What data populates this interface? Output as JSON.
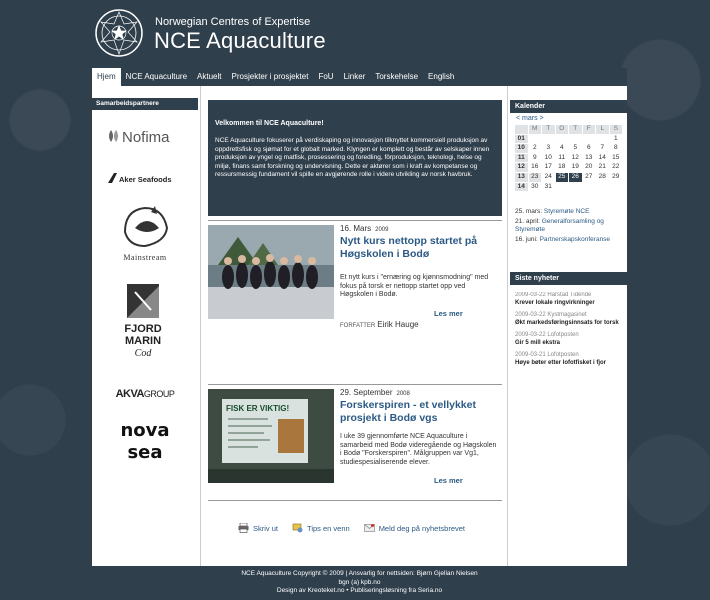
{
  "header": {
    "tagline": "Norwegian Centres of Expertise",
    "title": "NCE Aquaculture"
  },
  "nav": {
    "items": [
      {
        "label": "Hjem",
        "active": true
      },
      {
        "label": "NCE Aquaculture"
      },
      {
        "label": "Aktuelt"
      },
      {
        "label": "Prosjekter i prosjektet"
      },
      {
        "label": "FoU"
      },
      {
        "label": "Linker"
      },
      {
        "label": "Torskehelse"
      },
      {
        "label": "English"
      }
    ]
  },
  "partners": {
    "heading": "Samarbeidspartnere",
    "logos": [
      "Nofima",
      "Aker Seafoods",
      "Mainstream",
      "Fjord Marin Cod",
      "AKVA group",
      "Nova Sea"
    ]
  },
  "welcome": {
    "heading": "Velkommen til NCE Aquaculture!",
    "body": "NCE Aquaculture fokuserer på verdiskaping og innovasjon tilknyttet kommersiell produksjon av oppdrettsfisk og sjømat for et globalt marked. Klyngen er komplett og består av selskaper innen produksjon av yngel og matfisk, prosessering og foredling, fôrproduksjon, teknologi, helse og miljø, finans samt forskning og undervisning. Dette er aktører som i kraft av kompetanse og ressursmessig fundament vil spille en avgjørende rolle i videre utvikling av norsk havbruk."
  },
  "articles": [
    {
      "date": "16. Mars",
      "year": "2009",
      "title": "Nytt kurs nettopp startet på Høgskolen i Bodø",
      "body": "Et nytt kurs i \"ernæring og kjønnsmodning\" med fokus på torsk er nettopp startet opp ved Høgskolen i Bodø.",
      "more": "Les mer",
      "author_label": "FORFATTER",
      "author": "Eirik Hauge"
    },
    {
      "date": "29. September",
      "year": "2008",
      "title": "Forskerspiren - et vellykket prosjekt i Bodø vgs",
      "body": "I uke 39 gjennomførte NCE Aquaculture i samarbeid med Bodø videregående og Høgskolen i Bodø \"Forskerspiren\". Målgruppen var Vg1, studiespesialiserende elever.",
      "more": "Les mer",
      "photo_text": "FISK ER VIKTIG!"
    }
  ],
  "tools": {
    "print": "Skriv ut",
    "tip": "Tips en venn",
    "newsletter": "Meld deg på nyhetsbrevet"
  },
  "calendar": {
    "heading": "Kalender",
    "month_label": "<  mars  >",
    "days": [
      "M",
      "T",
      "O",
      "T",
      "F",
      "L",
      "S"
    ],
    "weeks": [
      {
        "wk": "09",
        "days": [
          "",
          "",
          "",
          "",
          "",
          "",
          "1"
        ]
      },
      {
        "wk": "10",
        "days": [
          "2",
          "3",
          "4",
          "5",
          "6",
          "7",
          "8"
        ]
      },
      {
        "wk": "11",
        "days": [
          "9",
          "10",
          "11",
          "12",
          "13",
          "14",
          "15"
        ]
      },
      {
        "wk": "12",
        "days": [
          "16",
          "17",
          "18",
          "19",
          "20",
          "21",
          "22"
        ]
      },
      {
        "wk": "13",
        "days": [
          "23",
          "24",
          "25",
          "26",
          "27",
          "28",
          "29"
        ]
      },
      {
        "wk": "14",
        "days": [
          "30",
          "31",
          "",
          "",
          "",
          "",
          ""
        ]
      }
    ],
    "first_week_label": "01"
  },
  "events": [
    {
      "date": "25. mars:",
      "title": "Styremøte NCE"
    },
    {
      "date": "21. april:",
      "title": "Generalforsamling og Styremøte"
    },
    {
      "date": "16. juni:",
      "title": "Partnerskapskonferanse"
    }
  ],
  "news": {
    "heading": "Siste nyheter",
    "items": [
      {
        "meta": "2009-03-22 Harstad Tidende",
        "title": "Krever lokale ringvirkninger"
      },
      {
        "meta": "2009-03-22 Kystmagasinet",
        "title": "Økt markedsføringsinnsats for torsk"
      },
      {
        "meta": "2009-03-22 Lofotposten",
        "title": "Gir 5 mill ekstra"
      },
      {
        "meta": "2009-03-21 Lofotposten",
        "title": "Høye bøter etter lofotfisket i fjor"
      }
    ]
  },
  "footer": {
    "line1": "NCE Aquaculture Copyright © 2009 | Ansvarlig for nettsiden: Bjørn Gjellan Nielsen",
    "line2": "bgn (a) kpb.no",
    "line3": "Design av Kreoteket.no • Publiseringsløsning fra Seria.no"
  },
  "colors": {
    "bg": "#2f3f4c",
    "link": "#2c5a85"
  }
}
